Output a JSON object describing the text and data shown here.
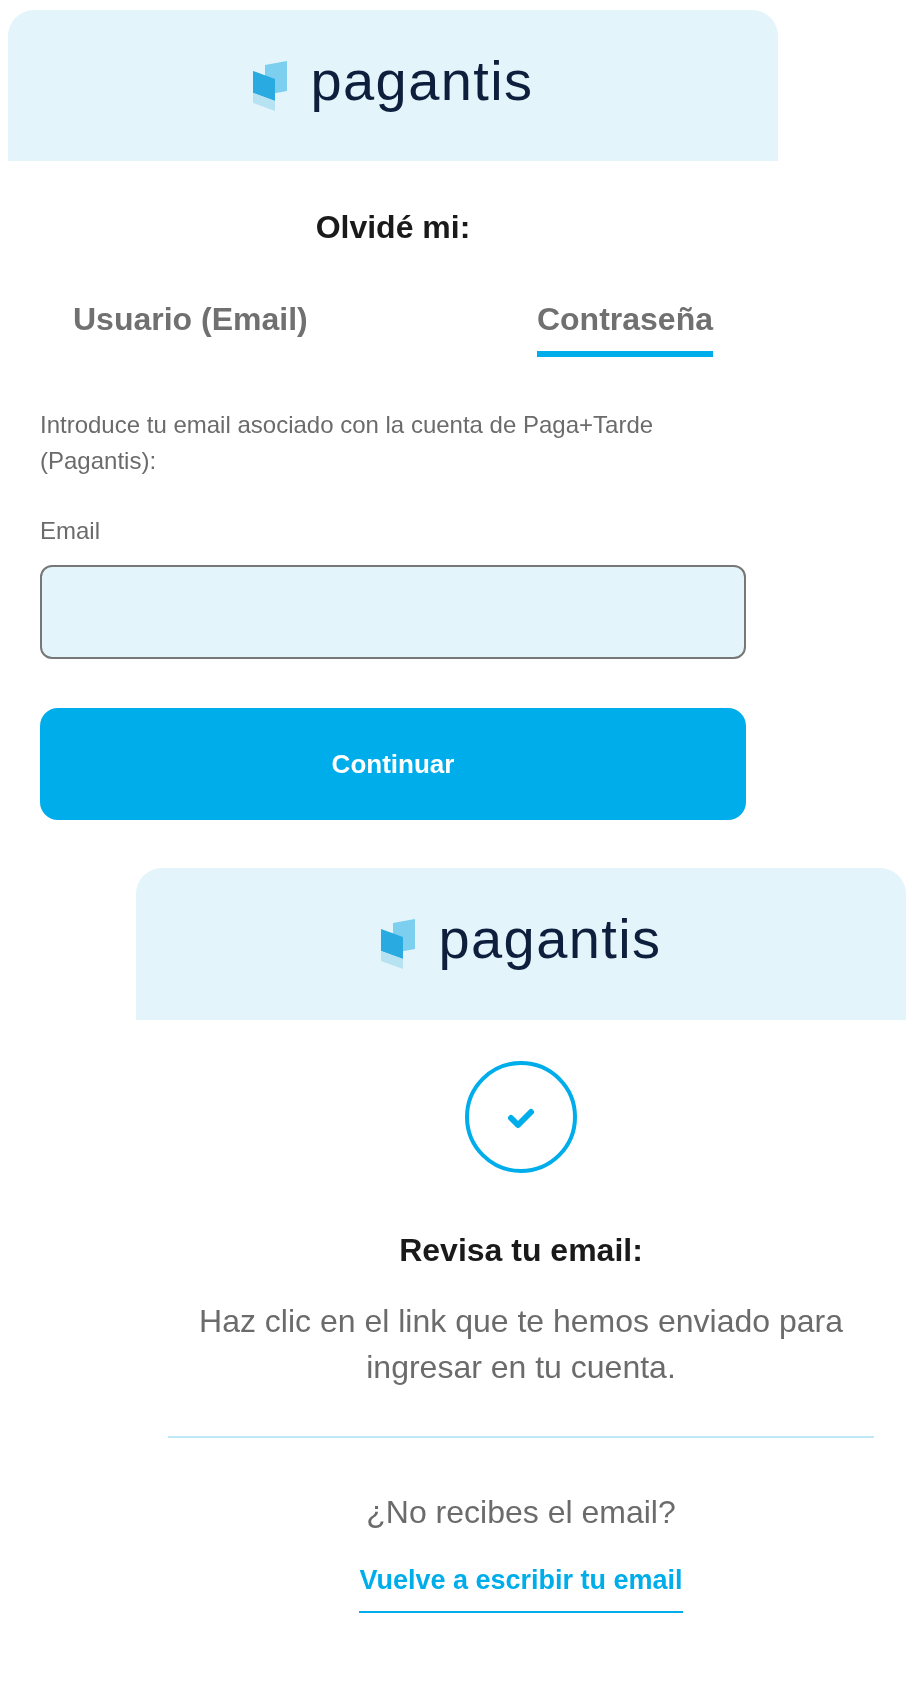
{
  "forgot_card": {
    "logo": "pagantis",
    "title": "Olvidé mi:",
    "tabs": [
      {
        "label": "Usuario (Email)",
        "selected": false
      },
      {
        "label": "Contraseña",
        "selected": true
      }
    ],
    "instructions": "Introduce tu email asociado con la cuenta de Paga+Tarde (Pagantis):",
    "email_label": "Email",
    "button": "Continuar"
  },
  "confirm_card": {
    "logo": "pagantis",
    "title": "Revisa tu email:",
    "message": "Haz clic en el link que te hemos enviado para ingresar en tu cuenta.",
    "question": "¿No recibes el email?",
    "link": "Vuelve a escribir tu email"
  }
}
